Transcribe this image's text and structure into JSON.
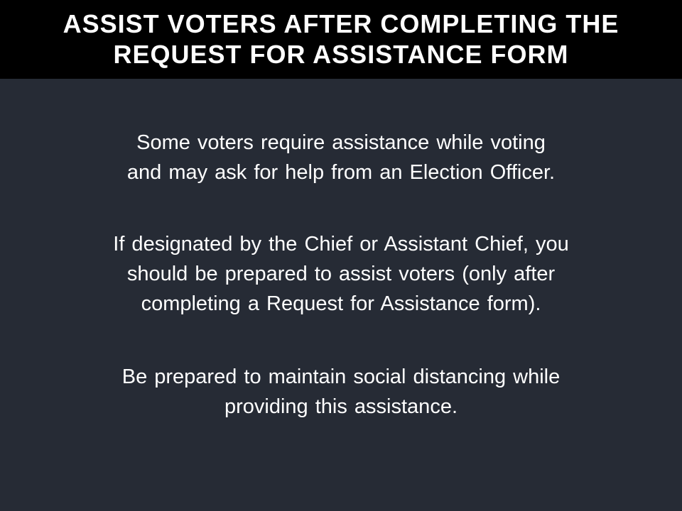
{
  "slide": {
    "title_lines": [
      "ASSIST VOTERS AFTER COMPLETING THE",
      "REQUEST FOR ASSISTANCE FORM"
    ],
    "paragraphs": [
      {
        "lines": [
          "Some voters require assistance while voting",
          "and may ask for help from an Election Officer."
        ]
      },
      {
        "lines": [
          "If designated by the Chief or Assistant Chief, you",
          "should be prepared to assist voters (only after",
          "completing a Request for Assistance form)."
        ]
      },
      {
        "lines": [
          "Be prepared to maintain social distancing while",
          "providing this assistance."
        ]
      }
    ]
  },
  "colors": {
    "title_bar": "#000000",
    "background": "#262b35",
    "text": "#ffffff"
  }
}
